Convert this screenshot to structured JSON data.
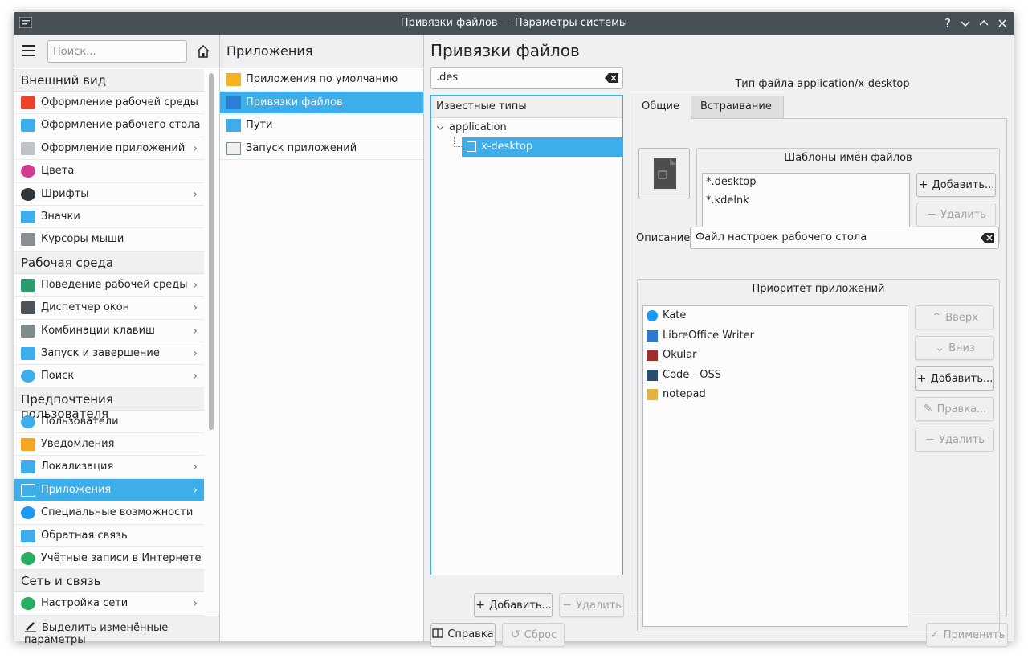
{
  "window": {
    "title": "Привязки файлов — Параметры системы"
  },
  "sidebar": {
    "search_placeholder": "Поиск...",
    "categories": [
      {
        "title": "Внешний вид",
        "items": [
          {
            "label": "Оформление рабочей среды",
            "icon": "plasma-theme-icon",
            "chevron": false
          },
          {
            "label": "Оформление рабочего стола",
            "icon": "workspace-theme-icon",
            "chevron": false
          },
          {
            "label": "Оформление приложений",
            "icon": "app-style-icon",
            "chevron": true
          },
          {
            "label": "Цвета",
            "icon": "colors-icon",
            "chevron": false
          },
          {
            "label": "Шрифты",
            "icon": "fonts-icon",
            "chevron": true
          },
          {
            "label": "Значки",
            "icon": "icons-icon",
            "chevron": false
          },
          {
            "label": "Курсоры мыши",
            "icon": "cursor-icon",
            "chevron": false
          }
        ]
      },
      {
        "title": "Рабочая среда",
        "items": [
          {
            "label": "Поведение рабочей среды",
            "icon": "workspace-behavior-icon",
            "chevron": true
          },
          {
            "label": "Диспетчер окон",
            "icon": "window-manager-icon",
            "chevron": true
          },
          {
            "label": "Комбинации клавиш",
            "icon": "keyboard-icon",
            "chevron": true
          },
          {
            "label": "Запуск и завершение",
            "icon": "startup-icon",
            "chevron": true
          },
          {
            "label": "Поиск",
            "icon": "search-icon",
            "chevron": true
          }
        ]
      },
      {
        "title": "Предпочтения пользователя",
        "items": [
          {
            "label": "Пользователи",
            "icon": "users-icon",
            "chevron": false
          },
          {
            "label": "Уведомления",
            "icon": "bell-icon",
            "chevron": false
          },
          {
            "label": "Локализация",
            "icon": "locale-icon",
            "chevron": true
          },
          {
            "label": "Приложения",
            "icon": "applications-icon",
            "chevron": true,
            "selected": true
          },
          {
            "label": "Специальные возможности",
            "icon": "accessibility-icon",
            "chevron": false
          },
          {
            "label": "Обратная связь",
            "icon": "feedback-icon",
            "chevron": false
          },
          {
            "label": "Учётные записи в Интернете",
            "icon": "online-accounts-icon",
            "chevron": false
          }
        ]
      },
      {
        "title": "Сеть и связь",
        "items": [
          {
            "label": "Настройка сети",
            "icon": "network-icon",
            "chevron": true
          }
        ]
      }
    ],
    "highlight_changed": "Выделить изменённые параметры"
  },
  "middle": {
    "title": "Приложения",
    "items": [
      {
        "label": "Приложения по умолчанию",
        "icon": "star-icon"
      },
      {
        "label": "Привязки файлов",
        "icon": "file-associations-icon",
        "selected": true
      },
      {
        "label": "Пути",
        "icon": "folder-icon"
      },
      {
        "label": "Запуск приложений",
        "icon": "launch-feedback-icon"
      }
    ]
  },
  "main": {
    "title": "Привязки файлов",
    "filter_value": ".des",
    "tree": {
      "header": "Известные типы",
      "parent": "application",
      "child": "x-desktop"
    },
    "add_button": "Добавить...",
    "remove_button": "Удалить",
    "help_button": "Справка",
    "reset_button": "Сброс",
    "apply_button": "Применить",
    "type_title": "Тип файла application/x-desktop",
    "tabs": [
      "Общие",
      "Встраивание"
    ],
    "patterns": {
      "title": "Шаблоны имён файлов",
      "items": [
        "*.desktop",
        "*.kdelnk"
      ],
      "add": "Добавить...",
      "remove": "Удалить"
    },
    "description": {
      "label": "Описание:",
      "value": "Файл настроек рабочего стола"
    },
    "priority": {
      "title": "Приоритет приложений",
      "items": [
        {
          "label": "Kate",
          "icon": "kate-icon"
        },
        {
          "label": "LibreOffice Writer",
          "icon": "writer-icon"
        },
        {
          "label": "Okular",
          "icon": "okular-icon"
        },
        {
          "label": "Code - OSS",
          "icon": "code-oss-icon"
        },
        {
          "label": "notepad",
          "icon": "notepad-icon"
        }
      ],
      "up": "Вверх",
      "down": "Вниз",
      "add": "Добавить...",
      "edit": "Правка...",
      "remove": "Удалить"
    }
  },
  "colors": {
    "accent": "#3daee9",
    "titlebar": "#475057",
    "window_bg": "#eff0f1"
  }
}
